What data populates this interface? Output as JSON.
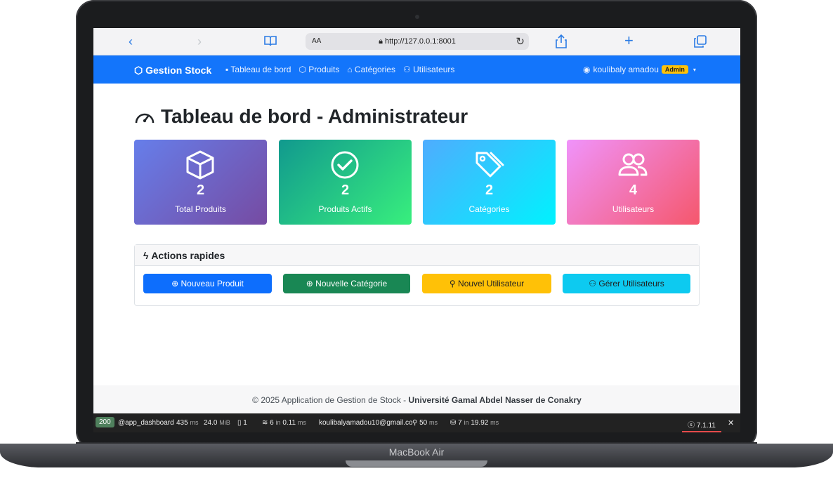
{
  "device": {
    "label": "MacBook Air"
  },
  "browser": {
    "reader_label": "AA",
    "url": "http://127.0.0.1:8001",
    "icons": [
      "back-icon",
      "forward-icon",
      "bookmarks-icon",
      "lock-icon",
      "reload-icon",
      "share-icon",
      "new-tab-icon",
      "tabs-icon"
    ]
  },
  "navbar": {
    "brand": "Gestion Stock",
    "links": [
      "Tableau de bord",
      "Produits",
      "Catégories",
      "Utilisateurs"
    ],
    "user_name": "koulibaly amadou",
    "user_badge": "Admin"
  },
  "page": {
    "title": "Tableau de bord - Administrateur"
  },
  "stats": [
    {
      "value": "2",
      "label": "Total Produits",
      "icon": "box-icon"
    },
    {
      "value": "2",
      "label": "Produits Actifs",
      "icon": "check-circle-icon"
    },
    {
      "value": "2",
      "label": "Catégories",
      "icon": "tags-icon"
    },
    {
      "value": "4",
      "label": "Utilisateurs",
      "icon": "users-icon"
    }
  ],
  "quick_actions": {
    "title": "Actions rapides",
    "buttons": [
      "Nouveau Produit",
      "Nouvelle Catégorie",
      "Nouvel Utilisateur",
      "Gérer Utilisateurs"
    ]
  },
  "footer": {
    "text": "© 2025 Application de Gestion de Stock - ",
    "institution": "Université Gamal Abdel Nasser de Conakry"
  },
  "debug_toolbar": {
    "status": "200",
    "route": "@app_dashboard",
    "time": "435",
    "time_unit": "ms",
    "memory": "24.0",
    "memory_unit": "MiB",
    "forms": "1",
    "cache": "6",
    "cache_in": "in",
    "cache_time": "0.11",
    "cache_unit": "ms",
    "user": "koulibalyamadou10@gmail.co",
    "events_time": "50",
    "events_unit": "ms",
    "db_queries": "7",
    "db_in": "in",
    "db_time": "19.92",
    "db_unit": "ms",
    "version": "7.1.11",
    "close": "✕"
  }
}
